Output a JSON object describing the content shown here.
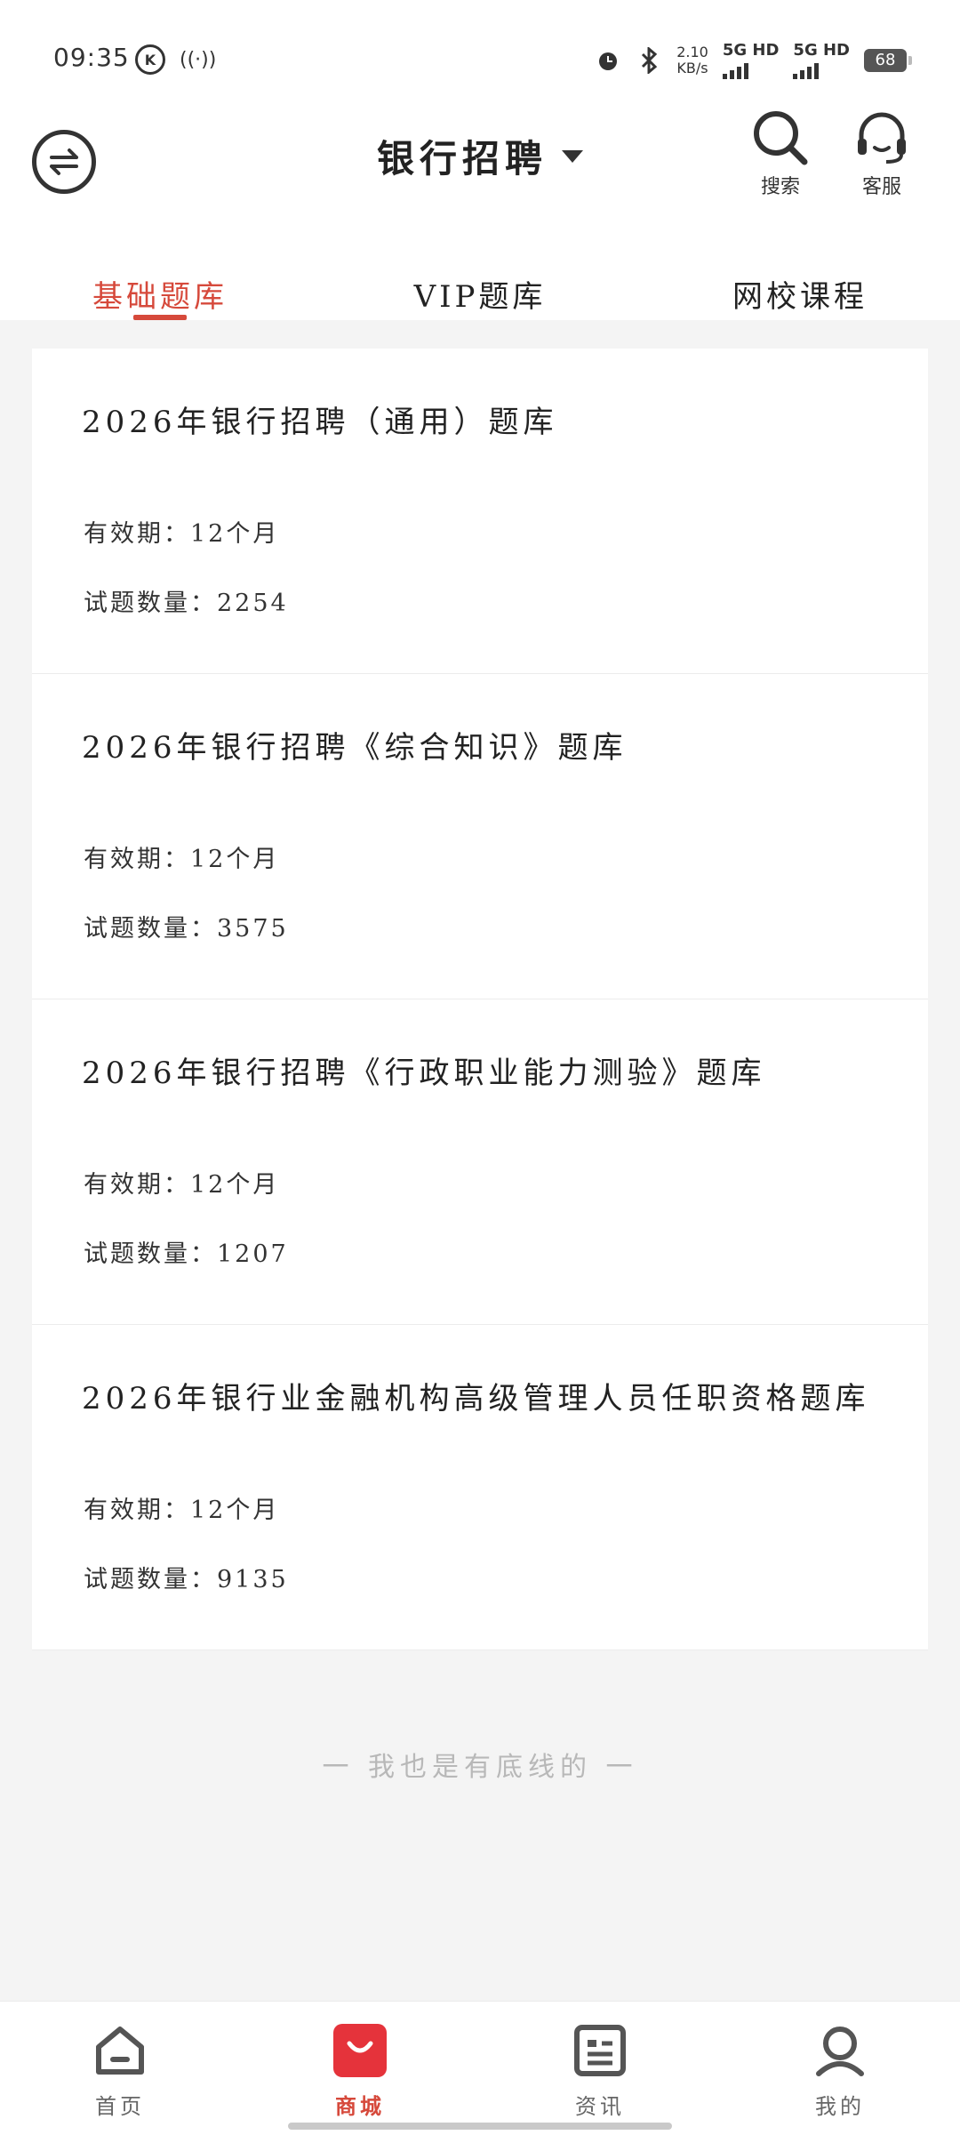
{
  "status_bar": {
    "time": "09:35",
    "k_label": "K",
    "network_speed_value": "2.10",
    "network_speed_unit": "KB/s",
    "network_1": "5G HD",
    "network_2": "5G HD",
    "battery": "68"
  },
  "header": {
    "title": "银行招聘",
    "search_label": "搜索",
    "service_label": "客服"
  },
  "tabs": [
    {
      "label": "基础题库",
      "active": true
    },
    {
      "label": "VIP题库",
      "active": false
    },
    {
      "label": "网校课程",
      "active": false
    }
  ],
  "question_banks": [
    {
      "title": "2026年银行招聘（通用）题库",
      "validity_label": "有效期：",
      "validity": "12个月",
      "count_label": "试题数量：",
      "count": "2254"
    },
    {
      "title": "2026年银行招聘《综合知识》题库",
      "validity_label": "有效期：",
      "validity": "12个月",
      "count_label": "试题数量：",
      "count": "3575"
    },
    {
      "title": "2026年银行招聘《行政职业能力测验》题库",
      "validity_label": "有效期：",
      "validity": "12个月",
      "count_label": "试题数量：",
      "count": "1207"
    },
    {
      "title": "2026年银行业金融机构高级管理人员任职资格题库",
      "validity_label": "有效期：",
      "validity": "12个月",
      "count_label": "试题数量：",
      "count": "9135"
    }
  ],
  "footer_note": "一 我也是有底线的 一",
  "bottom_nav": [
    {
      "label": "首页",
      "icon": "home-icon",
      "active": false
    },
    {
      "label": "商城",
      "icon": "shop-bag-icon",
      "active": true
    },
    {
      "label": "资讯",
      "icon": "news-icon",
      "active": false
    },
    {
      "label": "我的",
      "icon": "profile-icon",
      "active": false
    }
  ],
  "colors": {
    "accent": "#d6493b",
    "background": "#f4f4f4",
    "card": "#ffffff"
  }
}
